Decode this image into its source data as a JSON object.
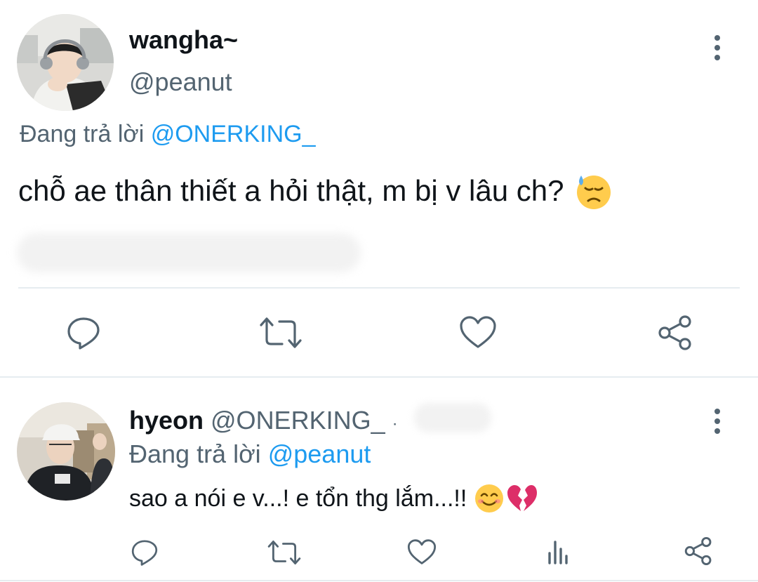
{
  "tweet1": {
    "display_name": "wangha~",
    "handle": "@peanut",
    "replying_prefix": "Đang trả lời",
    "replying_to": "@ONERKING_",
    "text": "chỗ ae thân thiết a hỏi thật, m bị v lâu ch?",
    "emoji": "downcast-face-with-sweat",
    "actions": [
      "reply-icon",
      "retweet-icon",
      "like-icon",
      "share-icon"
    ]
  },
  "tweet2": {
    "display_name": "hyeon",
    "handle": "@ONERKING_",
    "separator": "·",
    "replying_prefix": "Đang trả lời",
    "replying_to": "@peanut",
    "text": "sao a nói e v...! e tổn thg lắm...!!",
    "emojis": [
      "smiling-face-with-smiling-eyes",
      "broken-heart"
    ],
    "actions": [
      "reply-icon",
      "retweet-icon",
      "like-icon",
      "analytics-icon",
      "share-icon"
    ]
  },
  "colors": {
    "text": "#0f1419",
    "secondary": "#536471",
    "accent": "#1d9bf0",
    "divider": "#e6ecf0"
  }
}
